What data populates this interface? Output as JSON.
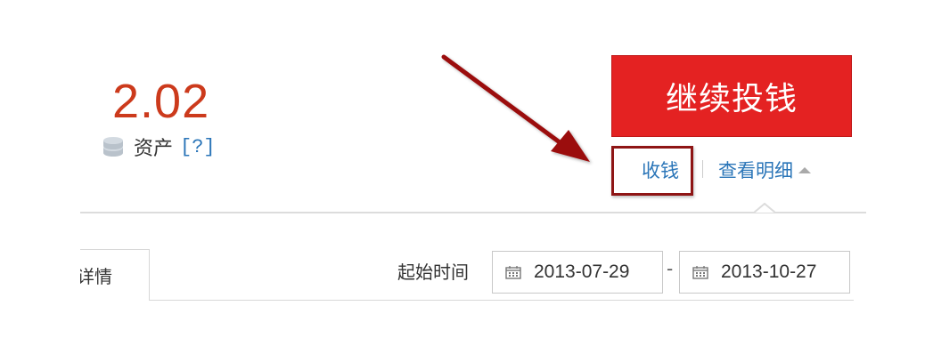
{
  "balance": {
    "value": "2.02",
    "label": "资产",
    "help": "[?]"
  },
  "actions": {
    "continue_label": "继续投钱",
    "withdraw_label": "收钱",
    "details_label": "查看明细"
  },
  "filter": {
    "tab_label": "详情",
    "date_label": "起始时间",
    "start_date": "2013-07-29",
    "range_separator": "-",
    "end_date": "2013-10-27"
  },
  "colors": {
    "balance": "#cc3a1c",
    "primary_button": "#e42222",
    "link": "#2a75b8",
    "annotation": "#9b1111"
  },
  "icons": {
    "asset": "coin-stack-icon",
    "date": "calendar-icon",
    "details_toggle": "caret-up-icon"
  }
}
